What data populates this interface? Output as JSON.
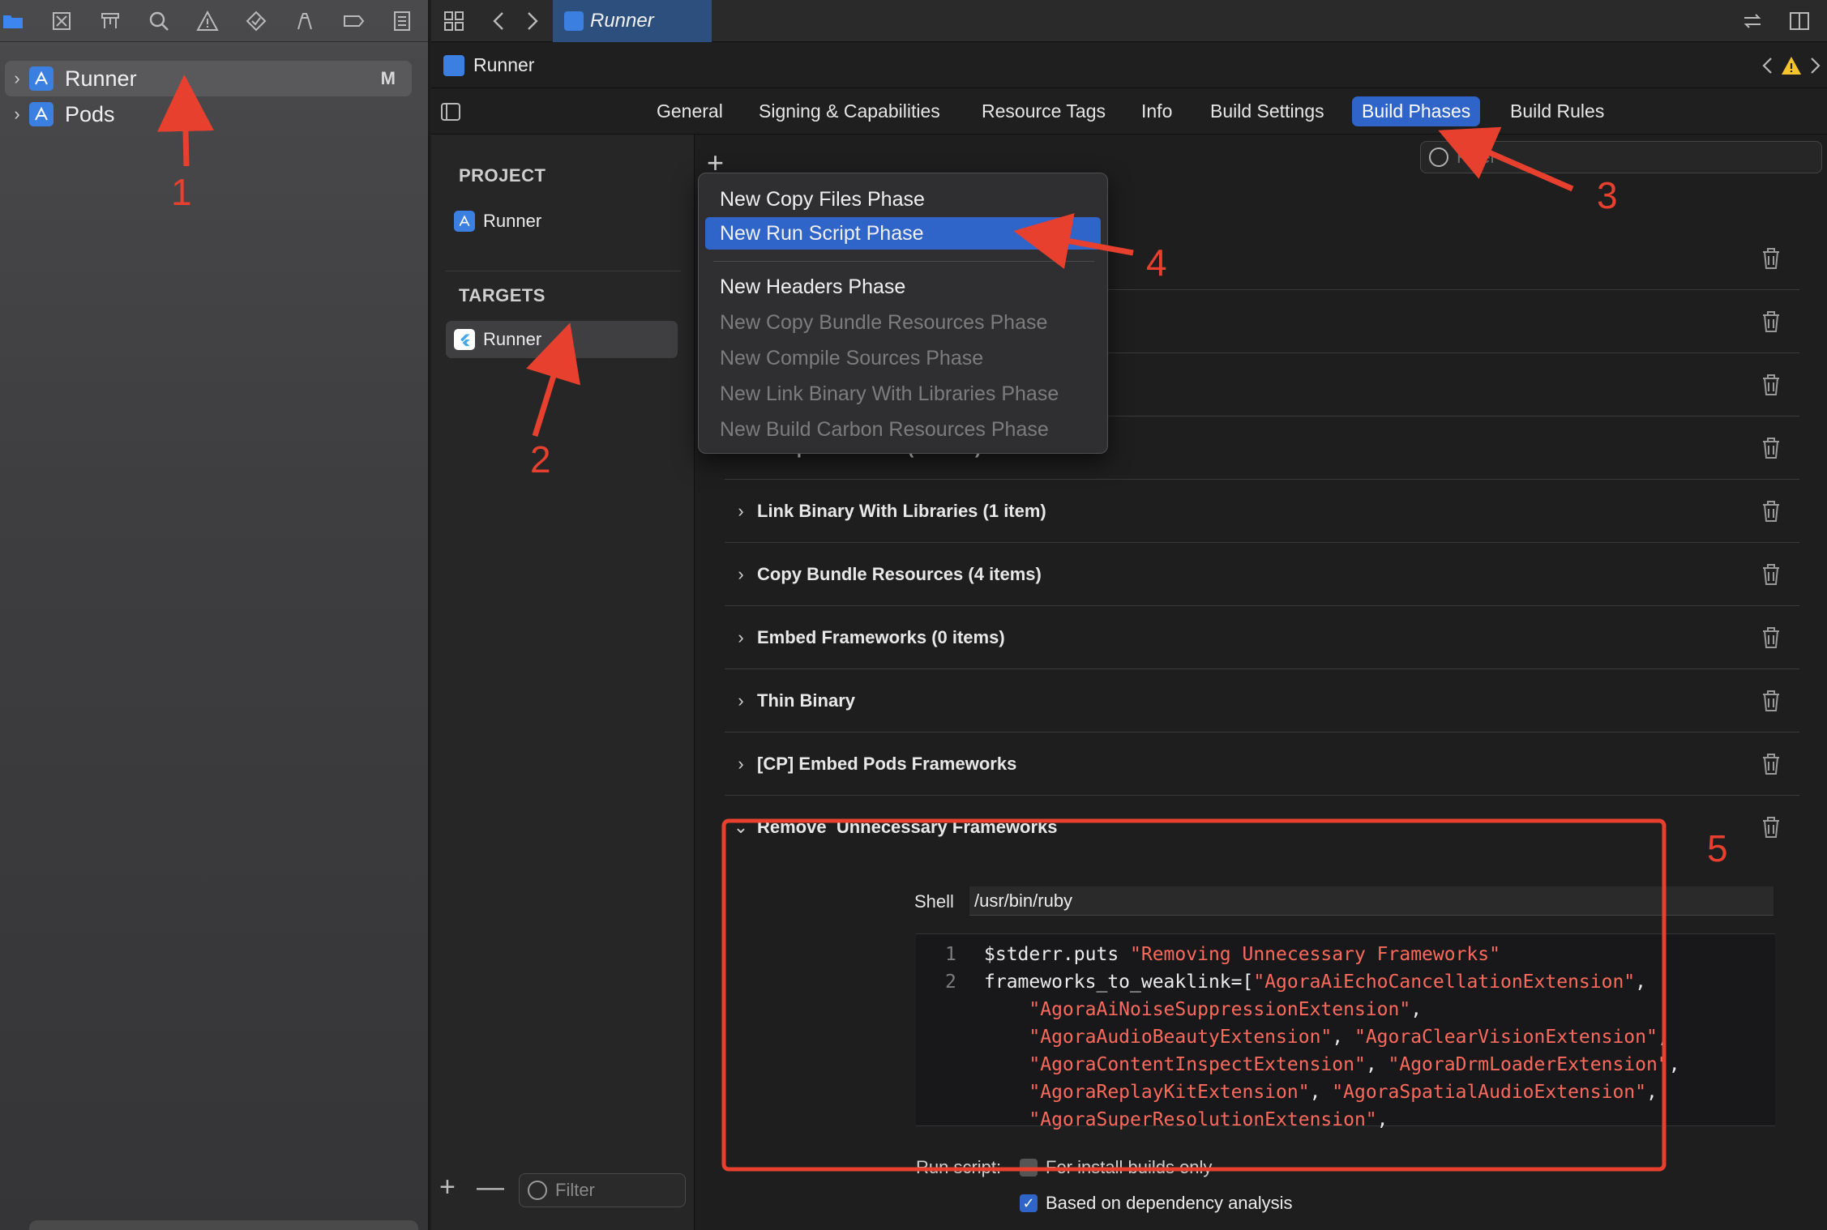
{
  "navigator": {
    "items": [
      {
        "label": "Runner",
        "badge": "M"
      },
      {
        "label": "Pods"
      }
    ],
    "filter_placeholder": "Filter"
  },
  "tabbar": {
    "active_tab": "Runner"
  },
  "jumpbar": {
    "project": "Runner"
  },
  "settings_tabs": [
    "General",
    "Signing & Capabilities",
    "Resource Tags",
    "Info",
    "Build Settings",
    "Build Phases",
    "Build Rules"
  ],
  "targets_column": {
    "project_header": "PROJECT",
    "project_item": "Runner",
    "targets_header": "TARGETS",
    "target_item": "Runner",
    "filter_placeholder": "Filter"
  },
  "phases_filter_placeholder": "Filter",
  "add_menu": {
    "items": [
      {
        "label": "New Copy Files Phase",
        "state": "enabled"
      },
      {
        "label": "New Run Script Phase",
        "state": "highlighted"
      },
      {
        "label": "New Headers Phase",
        "state": "enabled"
      },
      {
        "label": "New Copy Bundle Resources Phase",
        "state": "disabled"
      },
      {
        "label": "New Compile Sources Phase",
        "state": "disabled"
      },
      {
        "label": "New Link Binary With Libraries Phase",
        "state": "disabled"
      },
      {
        "label": "New Build Carbon Resources Phase",
        "state": "disabled"
      }
    ]
  },
  "phases": [
    "Compile Sources (2 items)",
    "Link Binary With Libraries (1 item)",
    "Copy Bundle Resources (4 items)",
    "Embed Frameworks (0 items)",
    "Thin Binary",
    "[CP] Embed Pods Frameworks"
  ],
  "expanded_phase": {
    "name": "Remove  Unnecessary Frameworks",
    "shell_label": "Shell",
    "shell_value": "/usr/bin/ruby",
    "code": [
      {
        "num": "1",
        "segments": [
          {
            "t": "$stderr.puts ",
            "k": "plain"
          },
          {
            "t": "\"Removing Unnecessary Frameworks\"",
            "k": "str"
          }
        ]
      },
      {
        "num": "2",
        "segments": [
          {
            "t": "frameworks_to_weaklink=[",
            "k": "plain"
          },
          {
            "t": "\"AgoraAiEchoCancellationExtension\"",
            "k": "str"
          },
          {
            "t": ",",
            "k": "plain"
          }
        ]
      },
      {
        "num": "",
        "segments": [
          {
            "t": "    ",
            "k": "plain"
          },
          {
            "t": "\"AgoraAiNoiseSuppressionExtension\"",
            "k": "str"
          },
          {
            "t": ",",
            "k": "plain"
          }
        ]
      },
      {
        "num": "",
        "segments": [
          {
            "t": "    ",
            "k": "plain"
          },
          {
            "t": "\"AgoraAudioBeautyExtension\"",
            "k": "str"
          },
          {
            "t": ", ",
            "k": "plain"
          },
          {
            "t": "\"AgoraClearVisionExtension\"",
            "k": "str"
          },
          {
            "t": ",",
            "k": "plain"
          }
        ]
      },
      {
        "num": "",
        "segments": [
          {
            "t": "    ",
            "k": "plain"
          },
          {
            "t": "\"AgoraContentInspectExtension\"",
            "k": "str"
          },
          {
            "t": ", ",
            "k": "plain"
          },
          {
            "t": "\"AgoraDrmLoaderExtension\"",
            "k": "str"
          },
          {
            "t": ",",
            "k": "plain"
          }
        ]
      },
      {
        "num": "",
        "segments": [
          {
            "t": "    ",
            "k": "plain"
          },
          {
            "t": "\"AgoraReplayKitExtension\"",
            "k": "str"
          },
          {
            "t": ", ",
            "k": "plain"
          },
          {
            "t": "\"AgoraSpatialAudioExtension\"",
            "k": "str"
          },
          {
            "t": ",",
            "k": "plain"
          }
        ]
      },
      {
        "num": "",
        "segments": [
          {
            "t": "    ",
            "k": "plain"
          },
          {
            "t": "\"AgoraSuperResolutionExtension\"",
            "k": "str"
          },
          {
            "t": ",",
            "k": "plain"
          }
        ]
      }
    ],
    "run_script_label": "Run script:",
    "install_builds_label": "For install builds only",
    "install_builds_checked": false,
    "dependency_label": "Based on dependency analysis",
    "dependency_checked": true
  },
  "annotations": [
    "1",
    "2",
    "3",
    "4",
    "5"
  ],
  "colors": {
    "accent": "#2f64c9",
    "annotation": "#e8402f",
    "string": "#fc6a5d"
  }
}
